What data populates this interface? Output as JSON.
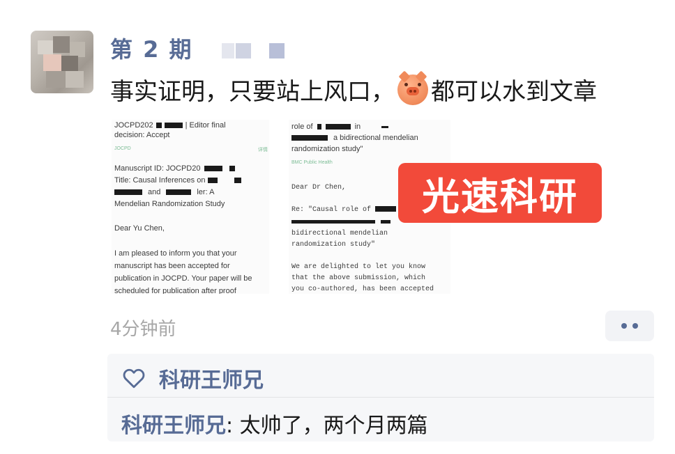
{
  "post": {
    "username": "第 2 期",
    "text_before": "事实证明，只要站上风口，",
    "emoji": "pig-face-icon",
    "text_after": "都可以水到文章",
    "timestamp": "4分钟前"
  },
  "screenshot_left": {
    "line1": "JOCPD202",
    "line1b": "| Editor final",
    "line2": "decision: Accept",
    "meta_left": "JOCPD",
    "meta_right": "详情",
    "line3": "Manuscript ID: JOCPD20",
    "line4": "Title: Causal Inferences on",
    "line5b": "ler: A",
    "line5": "and",
    "line6": "Mendelian Randomization Study",
    "line7": "Dear Yu Chen,",
    "line8": "I am pleased to inform you that your",
    "line9": "manuscript has been accepted for",
    "line10": "publication in JOCPD. Your paper will be",
    "line11": "scheduled for publication after proof"
  },
  "screenshot_right": {
    "line1": "role of",
    "line1b": "in",
    "line2": "a bidirectional mendelian",
    "line3": "randomization study\"",
    "meta": "BMC Public Health",
    "line4": "Dear Dr Chen,",
    "line5": "Re: \"Causal role of",
    "line6b": "bidirectional mendelian",
    "line7": "randomization study\"",
    "line8": "We are delighted to let you know",
    "line9": "that the above submission, which",
    "line10": "you co-authored, has been accepted"
  },
  "watermark_badge": "光速科研",
  "comments": {
    "like_name": "科研王师兄",
    "comment_author": "科研王师兄",
    "comment_sep": ": ",
    "comment_text": "太帅了，两个月两篇"
  },
  "colors": {
    "link_blue": "#576b95",
    "badge_red": "#f24a3a",
    "timestamp_gray": "#a7a7a7"
  }
}
